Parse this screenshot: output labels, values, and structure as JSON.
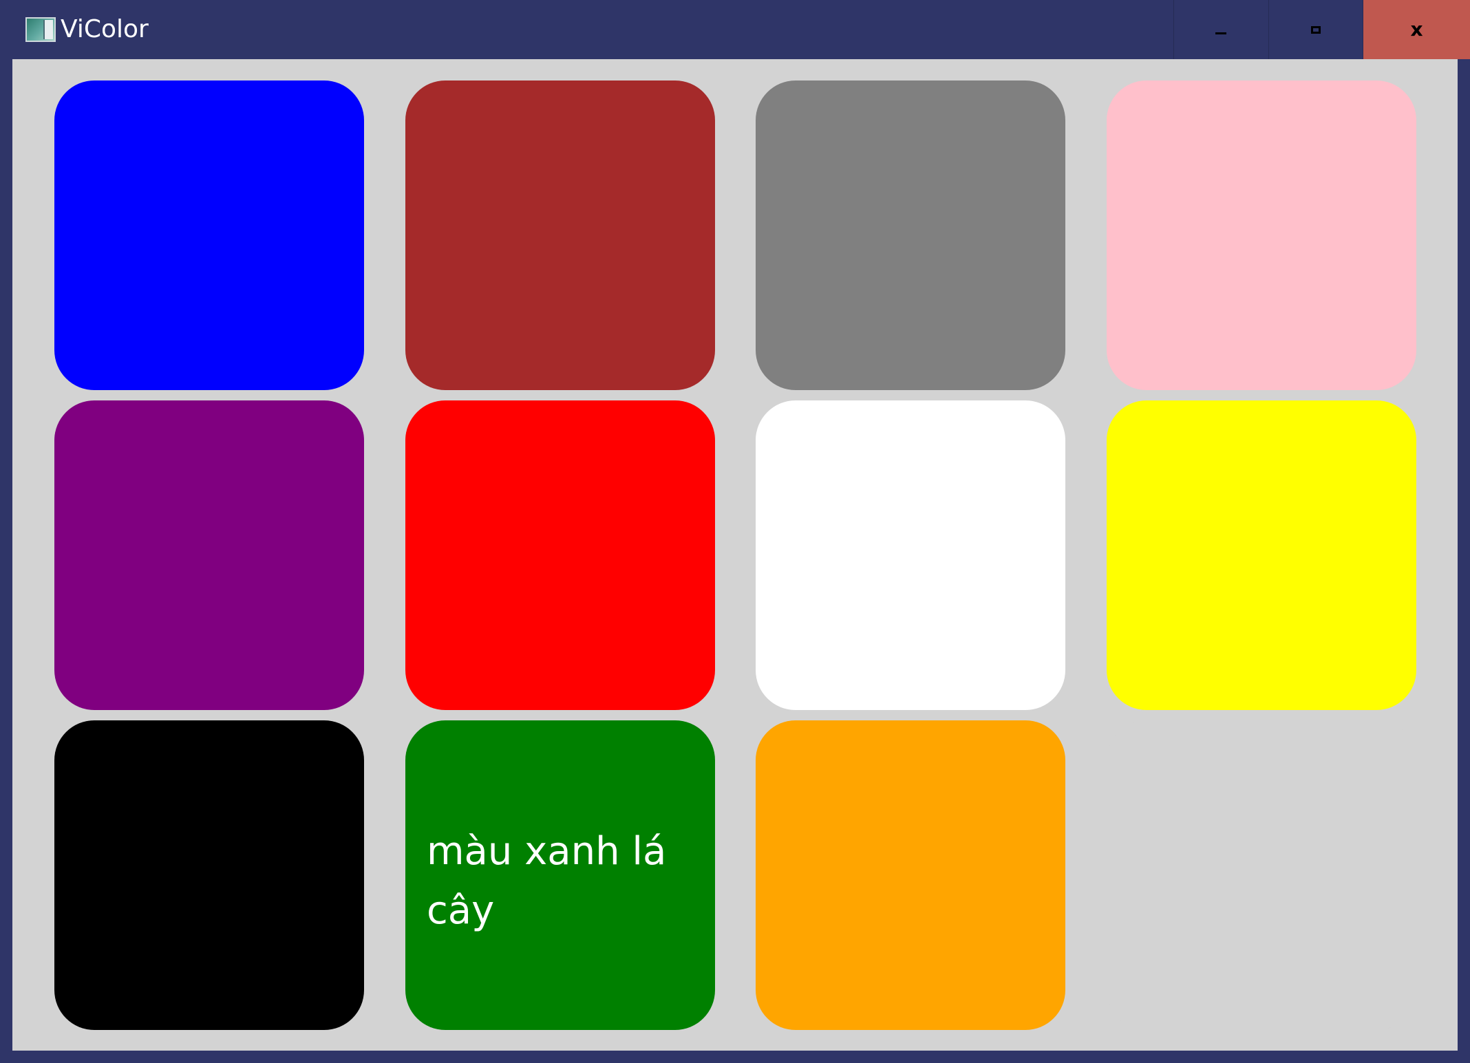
{
  "window": {
    "title": "ViColor",
    "icon": "app-window-icon",
    "caption_buttons": {
      "minimize_icon": "minimize-icon",
      "maximize_icon": "maximize-icon",
      "close_icon": "close-icon",
      "close_glyph": "x"
    },
    "titlebar_color": "#2f3568",
    "close_button_color": "#c0584f",
    "client_background": "#d3d3d3"
  },
  "tiles": [
    {
      "name": "blue",
      "color": "#0000ff",
      "label": ""
    },
    {
      "name": "brown",
      "color": "#a52a2a",
      "label": ""
    },
    {
      "name": "gray",
      "color": "#808080",
      "label": ""
    },
    {
      "name": "pink",
      "color": "#ffc0cb",
      "label": ""
    },
    {
      "name": "purple",
      "color": "#800080",
      "label": ""
    },
    {
      "name": "red",
      "color": "#ff0000",
      "label": ""
    },
    {
      "name": "white",
      "color": "#ffffff",
      "label": ""
    },
    {
      "name": "yellow",
      "color": "#ffff00",
      "label": ""
    },
    {
      "name": "black",
      "color": "#000000",
      "label": ""
    },
    {
      "name": "green",
      "color": "#008000",
      "label": "màu xanh lá cây"
    },
    {
      "name": "orange",
      "color": "#ffa500",
      "label": ""
    },
    {
      "name": "lightgray",
      "color": "#d3d3d3",
      "label": ""
    }
  ]
}
